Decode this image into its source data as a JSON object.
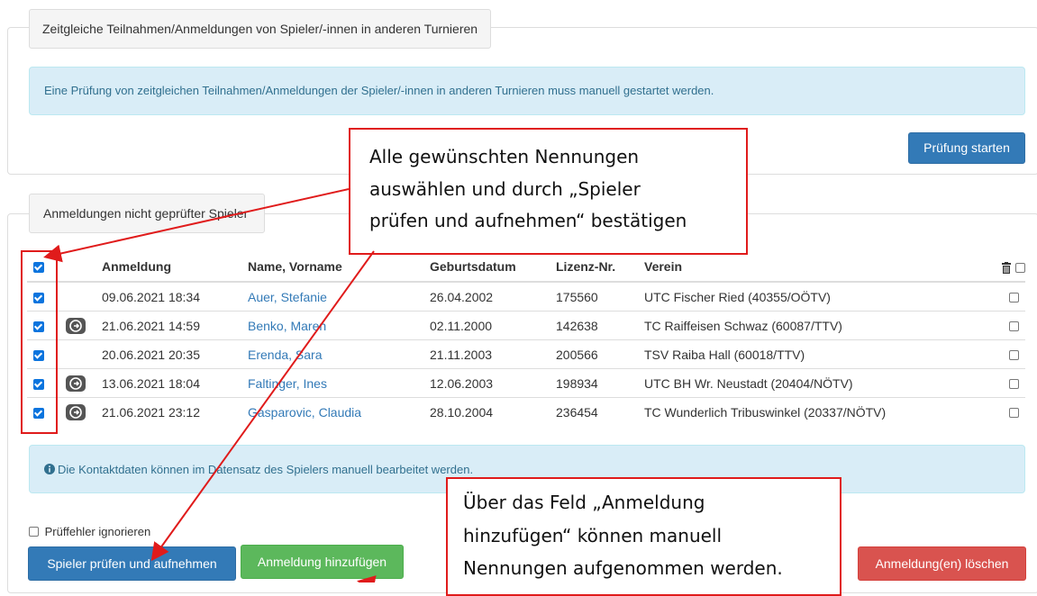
{
  "section1": {
    "legend": "Zeitgleiche Teilnahmen/Anmeldungen von Spieler/-innen in anderen Turnieren",
    "info": "Eine Prüfung von zeitgleichen Teilnahmen/Anmeldungen der Spieler/-innen in anderen Turnieren muss manuell gestartet werden.",
    "start_button": "Prüfung starten"
  },
  "section2": {
    "legend": "Anmeldungen nicht geprüfter Spieler",
    "columns": [
      "Anmeldung",
      "Name, Vorname",
      "Geburtsdatum",
      "Lizenz-Nr.",
      "Verein"
    ],
    "rows": [
      {
        "date": "09.06.2021 18:34",
        "name": "Auer, Stefanie",
        "birth": "26.04.2002",
        "license": "175560",
        "club": "UTC Fischer Ried (40355/OÖTV)",
        "share": false
      },
      {
        "date": "21.06.2021 14:59",
        "name": "Benko, Maren",
        "birth": "02.11.2000",
        "license": "142638",
        "club": "TC Raiffeisen Schwaz (60087/TTV)",
        "share": true
      },
      {
        "date": "20.06.2021 20:35",
        "name": "Erenda, Sara",
        "birth": "21.11.2003",
        "license": "200566",
        "club": "TSV Raiba Hall (60018/TTV)",
        "share": false
      },
      {
        "date": "13.06.2021 18:04",
        "name": "Faltinger, Ines",
        "birth": "12.06.2003",
        "license": "198934",
        "club": "UTC BH Wr. Neustadt (20404/NÖTV)",
        "share": true
      },
      {
        "date": "21.06.2021 23:12",
        "name": "Gasparovic, Claudia",
        "birth": "28.10.2004",
        "license": "236454",
        "club": "TC Wunderlich Tribuswinkel (20337/NÖTV)",
        "share": true
      }
    ],
    "info": "Die Kontaktdaten können im Datensatz des Spielers manuell bearbeitet werden.",
    "ignore_errors_label": "Prüffehler ignorieren",
    "check_add_button": "Spieler prüfen und aufnehmen",
    "add_button": "Anmeldung hinzufügen",
    "delete_button": "Anmeldung(en) löschen"
  },
  "callouts": {
    "top": [
      "Alle gewünschten Nennungen",
      "auswählen und durch „Spieler",
      "prüfen und aufnehmen“ bestätigen"
    ],
    "bottom": [
      "Über das Feld „Anmeldung",
      "hinzufügen“ können manuell",
      "Nennungen aufgenommen werden."
    ]
  },
  "icons": {
    "delete_header": "trash-icon",
    "row_action": "share-icon",
    "info": "info-circle-icon"
  },
  "colors": {
    "primary": "#337ab7",
    "success": "#5cb85c",
    "danger": "#d9534f",
    "annotation": "#e01b1b"
  }
}
